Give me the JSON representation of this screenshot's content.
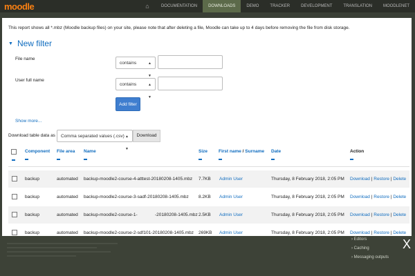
{
  "topbar": {
    "logo": "moodle",
    "home_icon": "home-icon",
    "nav": [
      "DOCUMENTATION",
      "DOWNLOADS",
      "DEMO",
      "TRACKER",
      "DEVELOPMENT",
      "TRANSLATION",
      "MOODLENET"
    ],
    "active_nav": "DOWNLOADS"
  },
  "modal": {
    "intro": "This report shows all *.mbz (Moodle backup files) on your site, please note that after deleting a file, Moodle can take up to 4 days before removing the file from disk storage.",
    "filter_title": "New filter",
    "filters": [
      {
        "label": "File name",
        "operator": "contains",
        "value": ""
      },
      {
        "label": "User full name",
        "operator": "contains",
        "value": ""
      }
    ],
    "add_filter": "Add filter",
    "show_more": "Show more...",
    "download_label": "Download table data as",
    "download_format": "Comma separated values (.csv)",
    "download_button": "Download",
    "table": {
      "headers": {
        "component": "Component",
        "filearea": "File area",
        "name": "Name",
        "size": "Size",
        "first_name": "First name",
        "name_sep": " / ",
        "surname": "Surname",
        "date": "Date",
        "action": "Action"
      },
      "rows": [
        {
          "component": "backup",
          "filearea": "automated",
          "name": "backup-moodle2-course-4-atttest-20180208-1405.mbz",
          "size": "7.7KB",
          "user": "Admin User",
          "date": "Thursday, 8 February 2018, 2:05 PM"
        },
        {
          "component": "backup",
          "filearea": "automated",
          "name": "backup-moodle2-course-3-sadf-20180208-1405.mbz",
          "size": "8.2KB",
          "user": "Admin User",
          "date": "Thursday, 8 February 2018, 2:05 PM"
        },
        {
          "component": "backup",
          "filearea": "automated",
          "name": "backup-moodle2-course-1-              -20180208-1405.mbz",
          "size": "2.5KB",
          "user": "Admin User",
          "date": "Thursday, 8 February 2018, 2:05 PM"
        },
        {
          "component": "backup",
          "filearea": "automated",
          "name": "backup-moodle2-course-2-sdf101-20180208-1405.mbz",
          "size": "269KB",
          "user": "Admin User",
          "date": "Thursday, 8 February 2018, 2:05 PM"
        }
      ],
      "actions": {
        "download": "Download",
        "restore": "Restore",
        "delete": "Delete",
        "sep": "|"
      }
    }
  },
  "background": {
    "sidebar": [
      "Editors",
      "Caching",
      "Messaging outputs"
    ]
  },
  "close_label": "X"
}
